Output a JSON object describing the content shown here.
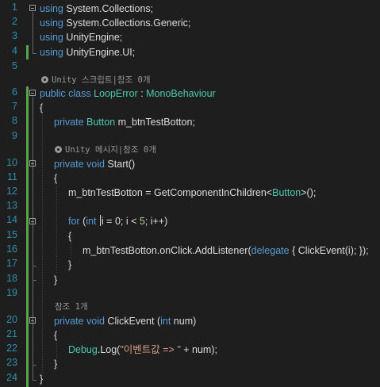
{
  "editor": {
    "line_numbers": [
      "1",
      "2",
      "3",
      "4",
      "5",
      "6",
      "7",
      "8",
      "9",
      "10",
      "11",
      "12",
      "13",
      "14",
      "15",
      "16",
      "17",
      "18",
      "19",
      "20",
      "21",
      "22",
      "23",
      "24"
    ],
    "code": {
      "l1": [
        "using",
        " System.Collections;"
      ],
      "l2": [
        "using",
        " System.Collections.Generic;"
      ],
      "l3": [
        "using",
        " UnityEngine;"
      ],
      "l4": [
        "using",
        " UnityEngine.UI;"
      ],
      "lens_class": "Unity 스크립트|참조 0개",
      "l6": [
        "public",
        " ",
        "class",
        " ",
        "LoopError",
        " : ",
        "MonoBehaviour"
      ],
      "l7": "{",
      "l8": [
        "private",
        " ",
        "Button",
        " m_btnTestBotton;"
      ],
      "lens_start": "Unity 메시지|참조 0개",
      "l10": [
        "private",
        " ",
        "void",
        " Start()"
      ],
      "l11": "{",
      "l12": [
        "m_btnTestBotton = GetComponentInChildren<",
        "Button",
        ">();"
      ],
      "l14": [
        "for",
        " (",
        "int",
        " ",
        "i",
        " = 0; i < ",
        "5",
        "; i++)"
      ],
      "l15": "{",
      "l16": [
        "m_btnTestBotton.onClick.AddListener(",
        "delegate",
        " { ClickEvent(i); });"
      ],
      "l17": "}",
      "l18": "}",
      "lens_click": "참조 1개",
      "l20": [
        "private",
        " ",
        "void",
        " ClickEvent (",
        "int",
        " num)"
      ],
      "l21": "{",
      "l22": [
        "Debug",
        ".Log(",
        "\"이벤트값 => \"",
        " + num);"
      ],
      "l23": "}",
      "l24": "}"
    }
  }
}
